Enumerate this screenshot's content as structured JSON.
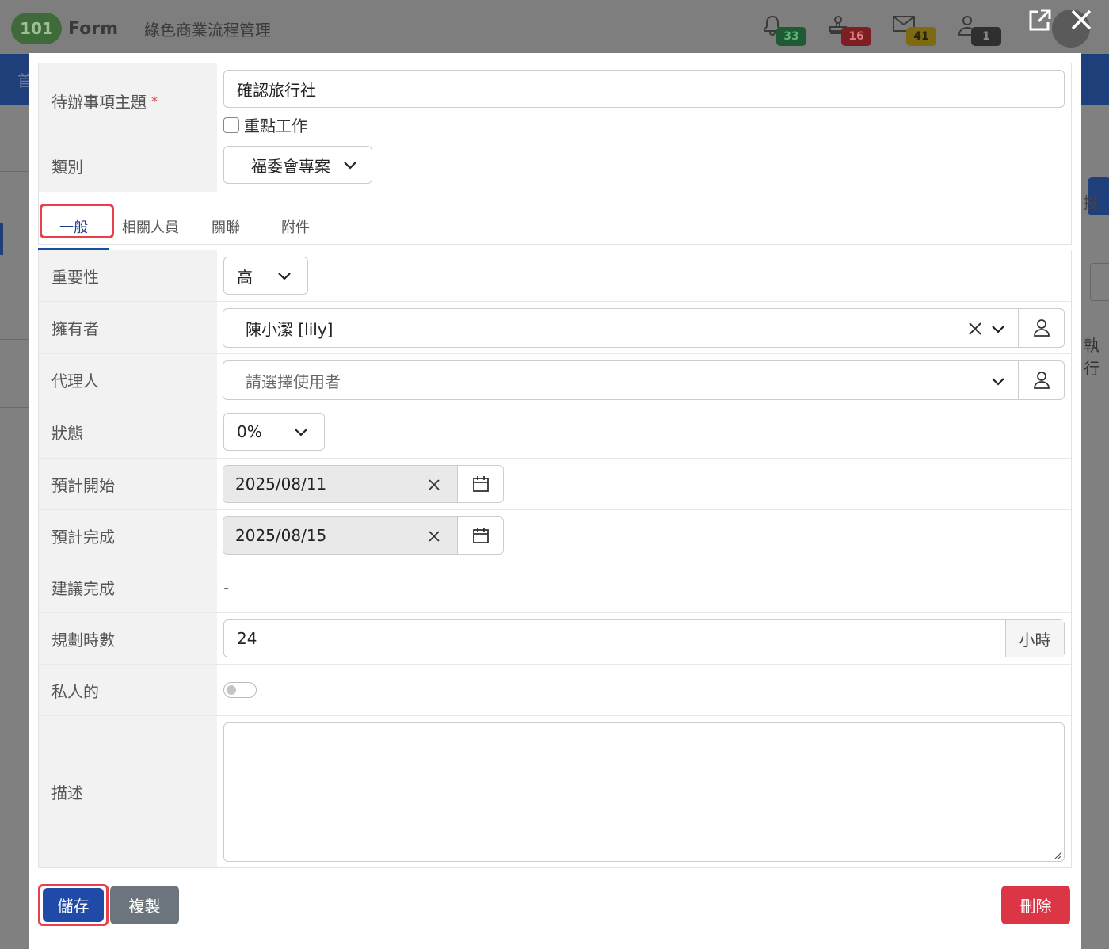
{
  "background": {
    "logo_num": "101",
    "brand": "Form",
    "subtitle": "綠色商業流程管理",
    "nav_char": "首",
    "right_char1": "投",
    "right_char2": "執行",
    "notifications": [
      {
        "icon": "bell-icon",
        "count": "33",
        "color": "#1e5b34"
      },
      {
        "icon": "stamp-icon",
        "count": "16",
        "color": "#7c1e22"
      },
      {
        "icon": "mail-icon",
        "count": "41",
        "color": "#7d6a12"
      },
      {
        "icon": "user-icon",
        "count": "1",
        "color": "#2f2f2f"
      }
    ]
  },
  "header_buttons": {
    "external": "⧉",
    "close": "✕"
  },
  "form": {
    "subject": {
      "label": "待辦事項主題",
      "required": "*",
      "value": "確認旅行社"
    },
    "important": {
      "label": "重點工作",
      "checked": false
    },
    "category": {
      "label": "類別",
      "value": "福委會專案"
    }
  },
  "tabs": [
    {
      "label": "一般",
      "active": true
    },
    {
      "label": "相關人員",
      "active": false
    },
    {
      "label": "關聯",
      "active": false
    },
    {
      "label": "附件",
      "active": false
    }
  ],
  "fields": {
    "priority": {
      "label": "重要性",
      "value": "高"
    },
    "owner": {
      "label": "擁有者",
      "value": "陳小潔 [lily]"
    },
    "agent": {
      "label": "代理人",
      "placeholder": "請選擇使用者"
    },
    "status": {
      "label": "狀態",
      "value": "0%"
    },
    "start": {
      "label": "預計開始",
      "value": "2025/08/11"
    },
    "finish": {
      "label": "預計完成",
      "value": "2025/08/15"
    },
    "suggested": {
      "label": "建議完成",
      "value": "-"
    },
    "hours": {
      "label": "規劃時數",
      "value": "24",
      "unit": "小時"
    },
    "private": {
      "label": "私人的",
      "on": false
    },
    "description": {
      "label": "描述",
      "value": ""
    }
  },
  "buttons": {
    "save": "儲存",
    "copy": "複製",
    "delete": "刪除"
  },
  "colors": {
    "primary": "#1f4aa8",
    "secondary": "#6c757d",
    "danger": "#dc3545",
    "highlight": "#e8414b"
  }
}
